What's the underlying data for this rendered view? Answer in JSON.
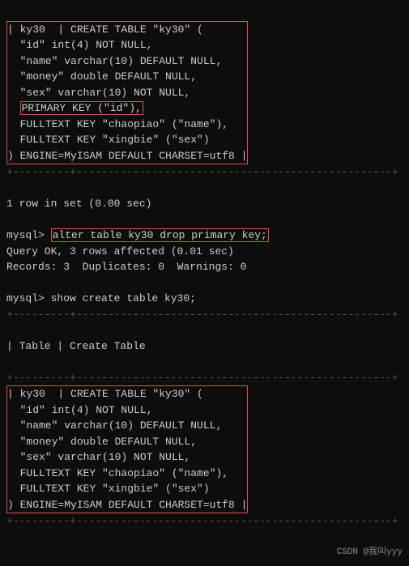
{
  "terminal": {
    "lines": [
      "| ky30  | CREATE TABLE \"ky30\" (",
      "  \"id\" int(4) NOT NULL,",
      "  \"name\" varchar(10) DEFAULT NULL,",
      "  \"money\" double DEFAULT NULL,",
      "  \"sex\" varchar(10) NOT NULL,",
      "  PRIMARY KEY (\"id\"),",
      "  FULLTEXT KEY \"chaopiao\" (\"name\"),",
      "  FULLTEXT KEY \"xingbie\" (\"sex\")",
      ") ENGINE=MyISAM DEFAULT CHARSET=utf8 |"
    ],
    "separator1": "+---------+",
    "separator_long": "+---------+--------------------------------------------------+",
    "row_result": "1 row in set (0.00 sec)",
    "blank": "",
    "prompt_alter": "mysql> alter table ky30 drop primary key;",
    "query_ok": "Query OK, 3 rows affected (0.01 sec)",
    "records": "Records: 3  Duplicates: 0  Warnings: 0",
    "prompt_show": "mysql> show create table ky30;",
    "table_header": "| Table | Create Table",
    "lines2": [
      "| ky30  | CREATE TABLE \"ky30\" (",
      "  \"id\" int(4) NOT NULL,",
      "  \"name\" varchar(10) DEFAULT NULL,",
      "  \"money\" double DEFAULT NULL,",
      "  \"sex\" varchar(10) NOT NULL,",
      "  FULLTEXT KEY \"chaopiao\" (\"name\"),",
      "  FULLTEXT KEY \"xingbie\" (\"sex\")",
      ") ENGINE=MyISAM DEFAULT CHARSET=utf8 |"
    ],
    "watermark": "CSDN @我叫yyy"
  }
}
